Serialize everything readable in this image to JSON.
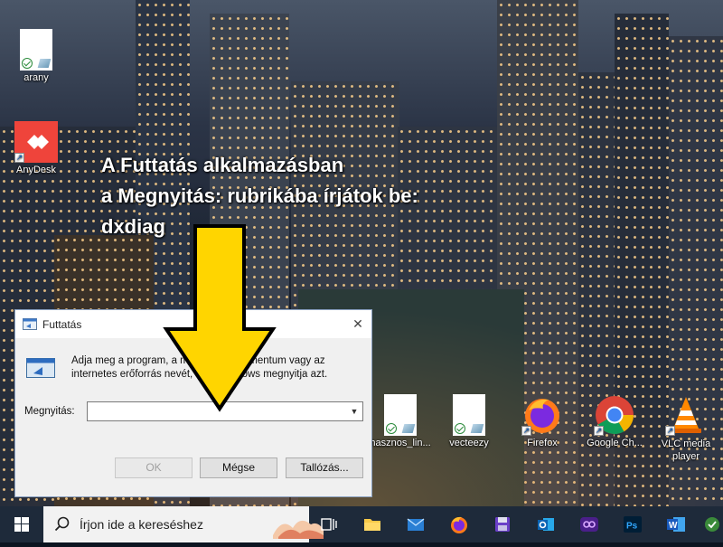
{
  "desktop": {
    "icons": [
      {
        "label": "arany",
        "icon": "document-icon"
      },
      {
        "label": "AnyDesk",
        "icon": "anydesk-icon"
      },
      {
        "label": "hasznos_lin...",
        "icon": "document-icon"
      },
      {
        "label": "vecteezy",
        "icon": "document-icon"
      },
      {
        "label": "Firefox",
        "icon": "firefox-icon"
      },
      {
        "label": "Google Ch...",
        "icon": "chrome-icon"
      },
      {
        "label": "VLC media player",
        "icon": "vlc-icon"
      }
    ]
  },
  "overlay": {
    "line1": "A Futtatás alkalmazásban",
    "line2": "a Megnyitás: rubrikába írjátok be:",
    "line3": "dxdiag"
  },
  "run_dialog": {
    "title": "Futtatás",
    "description": "Adja meg a program, a mappa, a dokumentum vagy az internetes erőforrás nevét, és a Windows megnyitja azt.",
    "open_label": "Megnyitás:",
    "open_value": "",
    "ok_label": "OK",
    "cancel_label": "Mégse",
    "browse_label": "Tallózás..."
  },
  "taskbar": {
    "search_placeholder": "Írjon ide a kereséshez",
    "apps": [
      "task-view-icon",
      "file-explorer-icon",
      "mail-icon",
      "firefox-icon",
      "save-icon",
      "outlook-icon",
      "eye-app-icon",
      "photoshop-icon",
      "word-icon",
      "apps-icon"
    ]
  },
  "colors": {
    "arrow_fill": "#ffd500",
    "anydesk_red": "#ef443b",
    "taskbar_bg": "#1e2a3a"
  }
}
